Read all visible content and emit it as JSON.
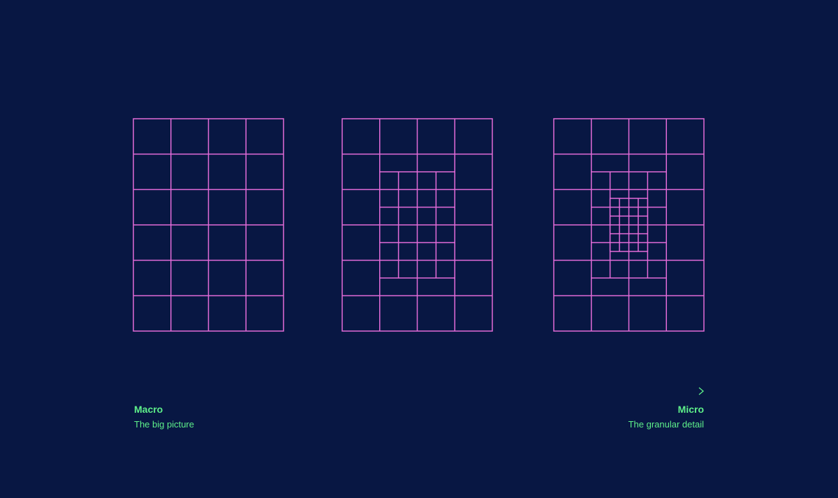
{
  "colors": {
    "background": "#081743",
    "grid_line": "#e26bd8",
    "accent": "#5ef08a"
  },
  "scale": {
    "left_title": "Macro",
    "left_subtitle": "The big picture",
    "right_title": "Micro",
    "right_subtitle": "The granular detail"
  },
  "diagrams": [
    {
      "name": "grid-macro",
      "base_cols": 4,
      "base_rows": 6,
      "refinement_levels": 0
    },
    {
      "name": "grid-mid",
      "base_cols": 4,
      "base_rows": 6,
      "refinement_levels": 1
    },
    {
      "name": "grid-micro",
      "base_cols": 4,
      "base_rows": 6,
      "refinement_levels": 2
    }
  ]
}
